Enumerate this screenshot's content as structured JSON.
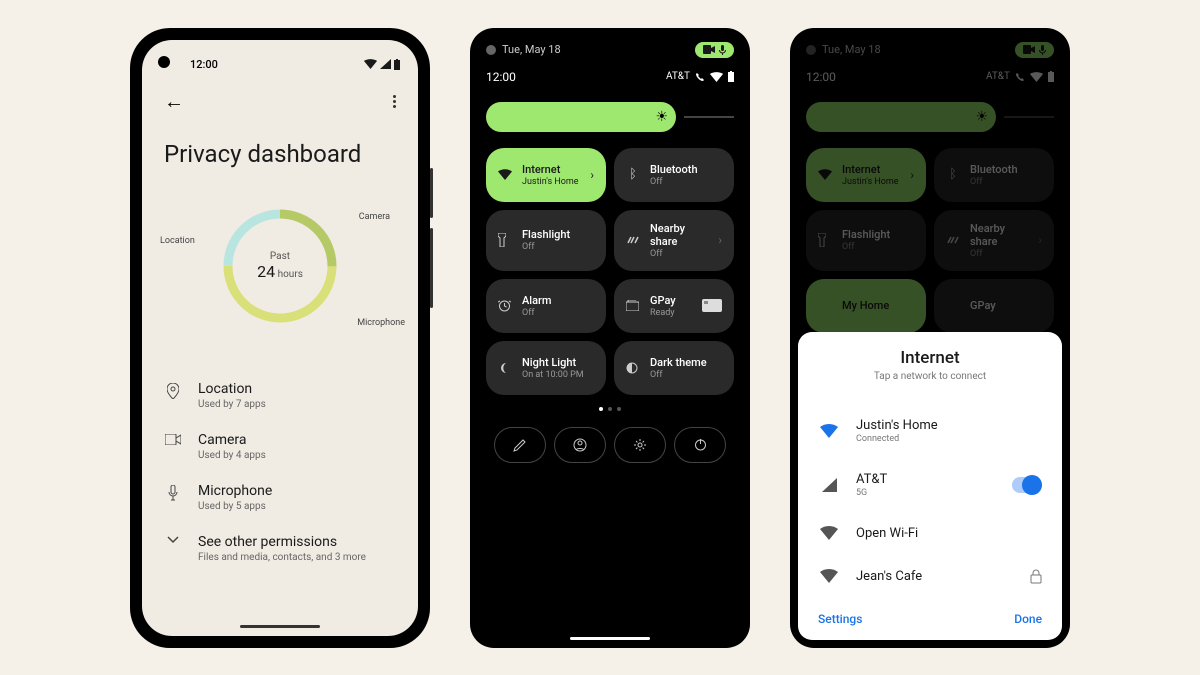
{
  "phone1": {
    "time": "12:00",
    "title": "Privacy dashboard",
    "donut_center_top": "Past",
    "donut_center_num": "24",
    "donut_center_unit": "hours",
    "labels": {
      "camera": "Camera",
      "location": "Location",
      "microphone": "Microphone"
    },
    "permissions": [
      {
        "icon": "location",
        "title": "Location",
        "sub": "Used by 7 apps"
      },
      {
        "icon": "camera",
        "title": "Camera",
        "sub": "Used by 4 apps"
      },
      {
        "icon": "mic",
        "title": "Microphone",
        "sub": "Used by 5 apps"
      },
      {
        "icon": "expand",
        "title": "See other permissions",
        "sub": "Files and media, contacts, and 3 more"
      }
    ]
  },
  "phone2": {
    "date": "Tue, May 18",
    "time": "12:00",
    "carrier": "AT&T",
    "tiles": [
      {
        "title": "Internet",
        "sub": "Justin's Home",
        "active": true,
        "chevron": true
      },
      {
        "title": "Bluetooth",
        "sub": "Off"
      },
      {
        "title": "Flashlight",
        "sub": "Off"
      },
      {
        "title": "Nearby share",
        "sub": "Off",
        "chevron": true
      },
      {
        "title": "Alarm",
        "sub": "Off"
      },
      {
        "title": "GPay",
        "sub": "Ready",
        "card": true
      },
      {
        "title": "Night Light",
        "sub": "On at 10:00 PM"
      },
      {
        "title": "Dark theme",
        "sub": "Off"
      }
    ]
  },
  "phone3": {
    "date": "Tue, May 18",
    "time": "12:00",
    "carrier": "AT&T",
    "tiles": [
      {
        "title": "Internet",
        "sub": "Justin's Home",
        "active": true,
        "chevron": true
      },
      {
        "title": "Bluetooth",
        "sub": "Off"
      },
      {
        "title": "Flashlight",
        "sub": "Off"
      },
      {
        "title": "Nearby share",
        "sub": "Off",
        "chevron": true
      },
      {
        "title": "My Home",
        "sub": "",
        "active": true
      },
      {
        "title": "GPay",
        "sub": ""
      }
    ],
    "sheet": {
      "title": "Internet",
      "sub": "Tap a network to connect",
      "networks": [
        {
          "name": "Justin's Home",
          "sub": "Connected",
          "icon": "wifi-blue"
        },
        {
          "name": "AT&T",
          "sub": "5G",
          "icon": "cell",
          "toggle": true
        },
        {
          "name": "Open Wi-Fi",
          "icon": "wifi-gray"
        },
        {
          "name": "Jean's Cafe",
          "icon": "wifi-gray",
          "lock": true
        }
      ],
      "settings": "Settings",
      "done": "Done"
    }
  },
  "chart_data": {
    "type": "pie",
    "title": "Privacy dashboard - Past 24 hours",
    "categories": [
      "Camera",
      "Microphone",
      "Location"
    ],
    "values": [
      25,
      50,
      25
    ],
    "colors": [
      "#b5c966",
      "#d9e07a",
      "#b8e5e0"
    ]
  }
}
